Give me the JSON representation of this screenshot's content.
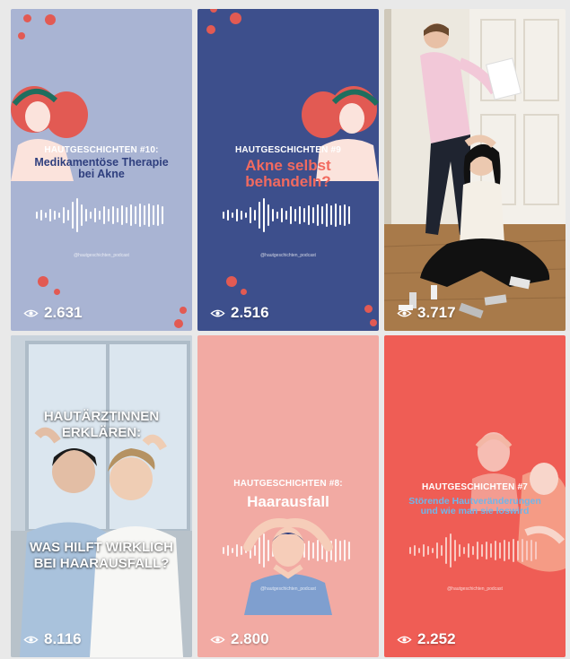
{
  "tiles": [
    {
      "kicker": "HAUTGESCHICHTEN #10:",
      "title_line1": "Medikamentöse Therapie",
      "title_line2": "bei Akne",
      "handle": "@hautgeschichten_podcast",
      "views": "2.631",
      "bg": "#a9b4d3"
    },
    {
      "kicker": "HAUTGESCHICHTEN #9",
      "title_line1": "Akne selbst",
      "title_line2": "behandeln?",
      "handle": "@hautgeschichten_podcast",
      "views": "2.516",
      "bg": "#3d4f8c"
    },
    {
      "views": "3.717",
      "bg": "#d9d2c4"
    },
    {
      "top_line1": "HAUTÄRZTINNEN",
      "top_line2": "ERKLÄREN:",
      "bottom_line1": "WAS HILFT WIRKLICH",
      "bottom_line2": "BEI HAARAUSFALL?",
      "views": "8.116",
      "bg": "#bcc8d2"
    },
    {
      "kicker": "HAUTGESCHICHTEN #8:",
      "title_line1": "Haarausfall",
      "handle": "@hautgeschichten_podcast",
      "views": "2.800",
      "bg": "#f2aaa3"
    },
    {
      "kicker": "HAUTGESCHICHTEN #7",
      "title_line1": "Störende Hautveränderungen",
      "title_line2": "und wie man sie loswird",
      "handle": "@hautgeschichten_podcast",
      "views": "2.252",
      "bg": "#ef5d55"
    }
  ],
  "colors": {
    "accent_red": "#e25a53",
    "navy_text": "#2f3f7e",
    "light_blue_text": "#6fb6ea"
  },
  "icons": {
    "views": "eye-icon",
    "audio": "soundwave-icon"
  }
}
